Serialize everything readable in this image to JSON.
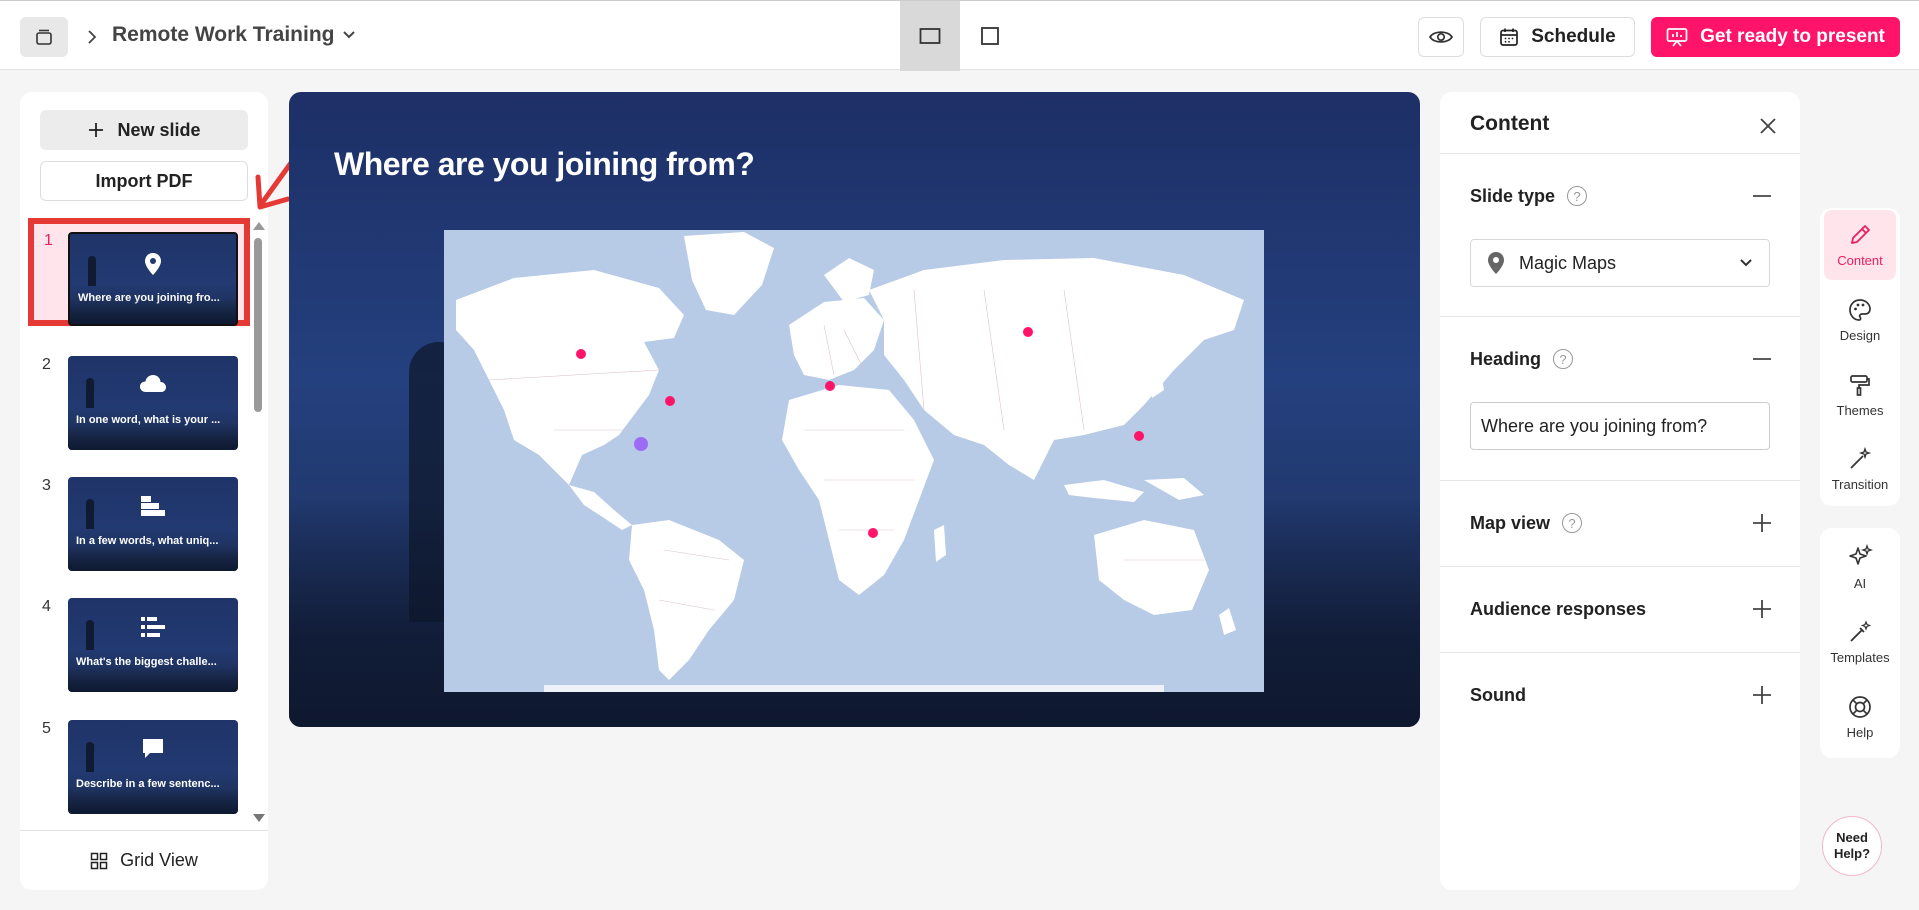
{
  "topbar": {
    "title": "Remote Work Training",
    "schedule_label": "Schedule",
    "present_label": "Get ready to present"
  },
  "left_panel": {
    "new_slide_label": "New slide",
    "import_pdf_label": "Import PDF",
    "slides": [
      {
        "num": "1",
        "text": "Where are you joining fro...",
        "icon": "map-pin-icon",
        "active": true
      },
      {
        "num": "2",
        "text": "In one word, what is your ...",
        "icon": "cloud-icon",
        "active": false
      },
      {
        "num": "3",
        "text": "In a few words, what uniq...",
        "icon": "ranking-icon",
        "active": false
      },
      {
        "num": "4",
        "text": "What's the biggest challe...",
        "icon": "bars-icon",
        "active": false
      },
      {
        "num": "5",
        "text": "Describe in a few sentenc...",
        "icon": "speech-bubble-icon",
        "active": false
      }
    ],
    "grid_view_label": "Grid View"
  },
  "canvas": {
    "heading": "Where are you joining from?"
  },
  "content_panel": {
    "title": "Content",
    "slide_type_label": "Slide type",
    "slide_type_value": "Magic Maps",
    "heading_label": "Heading",
    "heading_value": "Where are you joining from?",
    "map_view_label": "Map view",
    "audience_responses_label": "Audience responses",
    "sound_label": "Sound"
  },
  "rail": {
    "content": "Content",
    "design": "Design",
    "themes": "Themes",
    "transition": "Transition",
    "ai": "AI",
    "templates": "Templates",
    "help": "Help"
  },
  "need_help": {
    "line1": "Need",
    "line2": "Help?"
  },
  "colors": {
    "accent": "#ff1469",
    "annotation": "#e53935",
    "map_water": "#b7cae6",
    "slide_bg": "#223a72"
  }
}
